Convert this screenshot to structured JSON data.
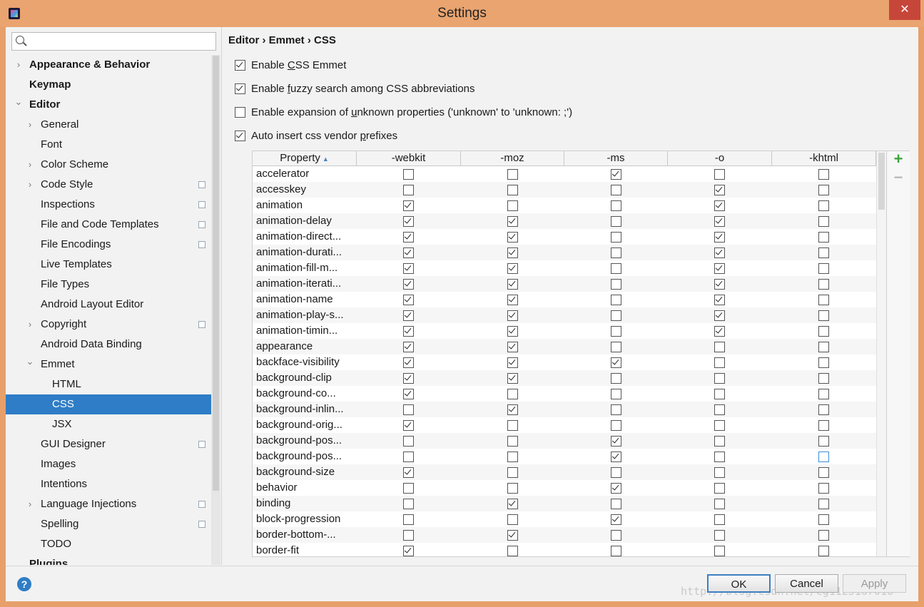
{
  "window": {
    "title": "Settings",
    "close_glyph": "✕"
  },
  "sidebar": {
    "search_placeholder": "",
    "items": [
      {
        "label": "Appearance & Behavior",
        "level": 0,
        "arrow": "right",
        "bold": true
      },
      {
        "label": "Keymap",
        "level": 0,
        "arrow": "",
        "bold": true
      },
      {
        "label": "Editor",
        "level": 0,
        "arrow": "down",
        "bold": true
      },
      {
        "label": "General",
        "level": 1,
        "arrow": "right"
      },
      {
        "label": "Font",
        "level": 1,
        "arrow": ""
      },
      {
        "label": "Color Scheme",
        "level": 1,
        "arrow": "right"
      },
      {
        "label": "Code Style",
        "level": 1,
        "arrow": "right",
        "copy": true
      },
      {
        "label": "Inspections",
        "level": 1,
        "arrow": "",
        "copy": true
      },
      {
        "label": "File and Code Templates",
        "level": 1,
        "arrow": "",
        "copy": true
      },
      {
        "label": "File Encodings",
        "level": 1,
        "arrow": "",
        "copy": true
      },
      {
        "label": "Live Templates",
        "level": 1,
        "arrow": ""
      },
      {
        "label": "File Types",
        "level": 1,
        "arrow": ""
      },
      {
        "label": "Android Layout Editor",
        "level": 1,
        "arrow": ""
      },
      {
        "label": "Copyright",
        "level": 1,
        "arrow": "right",
        "copy": true
      },
      {
        "label": "Android Data Binding",
        "level": 1,
        "arrow": ""
      },
      {
        "label": "Emmet",
        "level": 1,
        "arrow": "down"
      },
      {
        "label": "HTML",
        "level": 2,
        "arrow": ""
      },
      {
        "label": "CSS",
        "level": 2,
        "arrow": "",
        "selected": true
      },
      {
        "label": "JSX",
        "level": 2,
        "arrow": ""
      },
      {
        "label": "GUI Designer",
        "level": 1,
        "arrow": "",
        "copy": true
      },
      {
        "label": "Images",
        "level": 1,
        "arrow": ""
      },
      {
        "label": "Intentions",
        "level": 1,
        "arrow": ""
      },
      {
        "label": "Language Injections",
        "level": 1,
        "arrow": "right",
        "copy": true
      },
      {
        "label": "Spelling",
        "level": 1,
        "arrow": "",
        "copy": true
      },
      {
        "label": "TODO",
        "level": 1,
        "arrow": ""
      },
      {
        "label": "Plugins",
        "level": 0,
        "arrow": "",
        "bold": true
      }
    ]
  },
  "breadcrumb": "Editor › Emmet › CSS",
  "options": [
    {
      "pre": "Enable ",
      "u": "C",
      "post": "SS Emmet",
      "checked": true
    },
    {
      "pre": "Enable ",
      "u": "f",
      "post": "uzzy search among CSS abbreviations",
      "checked": true
    },
    {
      "pre": "Enable expansion of ",
      "u": "u",
      "post": "nknown properties ('unknown' to 'unknown: ;')",
      "checked": false
    },
    {
      "pre": "Auto insert css vendor ",
      "u": "p",
      "post": "refixes",
      "checked": true
    }
  ],
  "table": {
    "columns": [
      "Property",
      "-webkit",
      "-moz",
      "-ms",
      "-o",
      "-khtml"
    ],
    "rows": [
      {
        "name": "accelerator",
        "v": [
          0,
          0,
          1,
          0,
          0
        ]
      },
      {
        "name": "accesskey",
        "v": [
          0,
          0,
          0,
          1,
          0
        ]
      },
      {
        "name": "animation",
        "v": [
          1,
          0,
          0,
          1,
          0
        ]
      },
      {
        "name": "animation-delay",
        "v": [
          1,
          1,
          0,
          1,
          0
        ]
      },
      {
        "name": "animation-direct...",
        "v": [
          1,
          1,
          0,
          1,
          0
        ]
      },
      {
        "name": "animation-durati...",
        "v": [
          1,
          1,
          0,
          1,
          0
        ]
      },
      {
        "name": "animation-fill-m...",
        "v": [
          1,
          1,
          0,
          1,
          0
        ]
      },
      {
        "name": "animation-iterati...",
        "v": [
          1,
          1,
          0,
          1,
          0
        ]
      },
      {
        "name": "animation-name",
        "v": [
          1,
          1,
          0,
          1,
          0
        ]
      },
      {
        "name": "animation-play-s...",
        "v": [
          1,
          1,
          0,
          1,
          0
        ]
      },
      {
        "name": "animation-timin...",
        "v": [
          1,
          1,
          0,
          1,
          0
        ]
      },
      {
        "name": "appearance",
        "v": [
          1,
          1,
          0,
          0,
          0
        ]
      },
      {
        "name": "backface-visibility",
        "v": [
          1,
          1,
          1,
          0,
          0
        ]
      },
      {
        "name": "background-clip",
        "v": [
          1,
          1,
          0,
          0,
          0
        ]
      },
      {
        "name": "background-co...",
        "v": [
          1,
          0,
          0,
          0,
          0
        ]
      },
      {
        "name": "background-inlin...",
        "v": [
          0,
          1,
          0,
          0,
          0
        ]
      },
      {
        "name": "background-orig...",
        "v": [
          1,
          0,
          0,
          0,
          0
        ]
      },
      {
        "name": "background-pos...",
        "v": [
          0,
          0,
          1,
          0,
          0
        ]
      },
      {
        "name": "background-pos...",
        "v": [
          0,
          0,
          1,
          0,
          0
        ],
        "focus": 4
      },
      {
        "name": "background-size",
        "v": [
          1,
          0,
          0,
          0,
          0
        ]
      },
      {
        "name": "behavior",
        "v": [
          0,
          0,
          1,
          0,
          0
        ]
      },
      {
        "name": "binding",
        "v": [
          0,
          1,
          0,
          0,
          0
        ]
      },
      {
        "name": "block-progression",
        "v": [
          0,
          0,
          1,
          0,
          0
        ]
      },
      {
        "name": "border-bottom-...",
        "v": [
          0,
          1,
          0,
          0,
          0
        ]
      },
      {
        "name": "border-fit",
        "v": [
          1,
          0,
          0,
          0,
          0
        ]
      }
    ],
    "add_glyph": "+",
    "remove_glyph": "−"
  },
  "buttons": {
    "ok": "OK",
    "cancel": "Cancel",
    "apply": "Apply",
    "help": "?"
  },
  "watermark": "http://blog.csdn.net/cg1125167016"
}
